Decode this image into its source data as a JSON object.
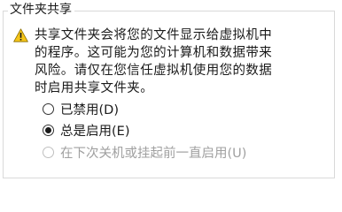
{
  "group": {
    "title": "文件夹共享"
  },
  "warning": {
    "icon": "warning-icon",
    "text": "共享文件夹会将您的文件显示给虚拟机中\n的程序。这可能为您的计算机和数据带来\n风险。请仅在您信任虚拟机使用您的数据\n时启用共享文件夹。"
  },
  "options": [
    {
      "label": "已禁用(D)",
      "checked": false,
      "enabled": true
    },
    {
      "label": "总是启用(E)",
      "checked": true,
      "enabled": true
    },
    {
      "label": "在下次关机或挂起前一直启用(U)",
      "checked": false,
      "enabled": false
    }
  ],
  "colors": {
    "warning_yellow": "#f5c518",
    "disabled_text": "#a0a0a0",
    "border": "#d9d9d9"
  }
}
